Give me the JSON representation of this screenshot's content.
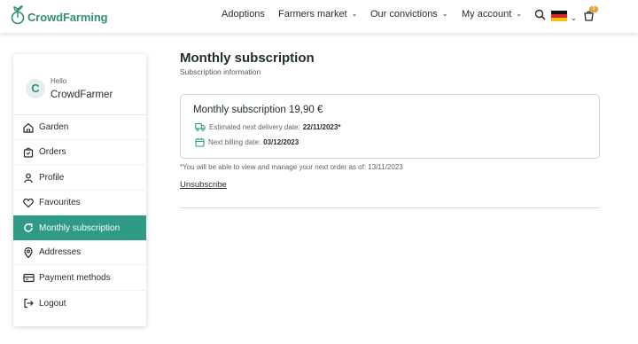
{
  "brand": {
    "name": "CrowdFarming",
    "color": "#2f8f79"
  },
  "nav": {
    "adoptions": "Adoptions",
    "farmers_market": "Farmers market",
    "our_convictions": "Our convictions",
    "my_account": "My account",
    "cart_count": "0"
  },
  "icons": {
    "search": "search-icon",
    "flag": "germany-flag-icon",
    "cart": "cart-icon"
  },
  "sidebar": {
    "greeting": "Hello",
    "user_name": "CrowdFarmer",
    "avatar_letter": "C",
    "items": [
      {
        "label": "Garden",
        "icon": "garden-icon"
      },
      {
        "label": "Orders",
        "icon": "orders-icon"
      },
      {
        "label": "Profile",
        "icon": "profile-icon"
      },
      {
        "label": "Favourites",
        "icon": "heart-icon"
      },
      {
        "label": "Monthly subscription",
        "icon": "refresh-icon",
        "active": true
      },
      {
        "label": "Addresses",
        "icon": "location-icon"
      },
      {
        "label": "Payment methods",
        "icon": "credit-card-icon"
      },
      {
        "label": "Logout",
        "icon": "logout-icon"
      }
    ],
    "active_color": "#2f9a86"
  },
  "main": {
    "title": "Monthly subscription",
    "subtitle": "Subscription information",
    "card": {
      "title": "Monthly subscription 19,90 €",
      "delivery_label": "Estimated next delivery date:",
      "delivery_value": "22/11/2023*",
      "billing_label": "Next billing date:",
      "billing_value": "03/12/2023"
    },
    "note": "*You will be able to view and manage your next order as of: 13/11/2023",
    "unsubscribe": "Unsubscribe"
  }
}
